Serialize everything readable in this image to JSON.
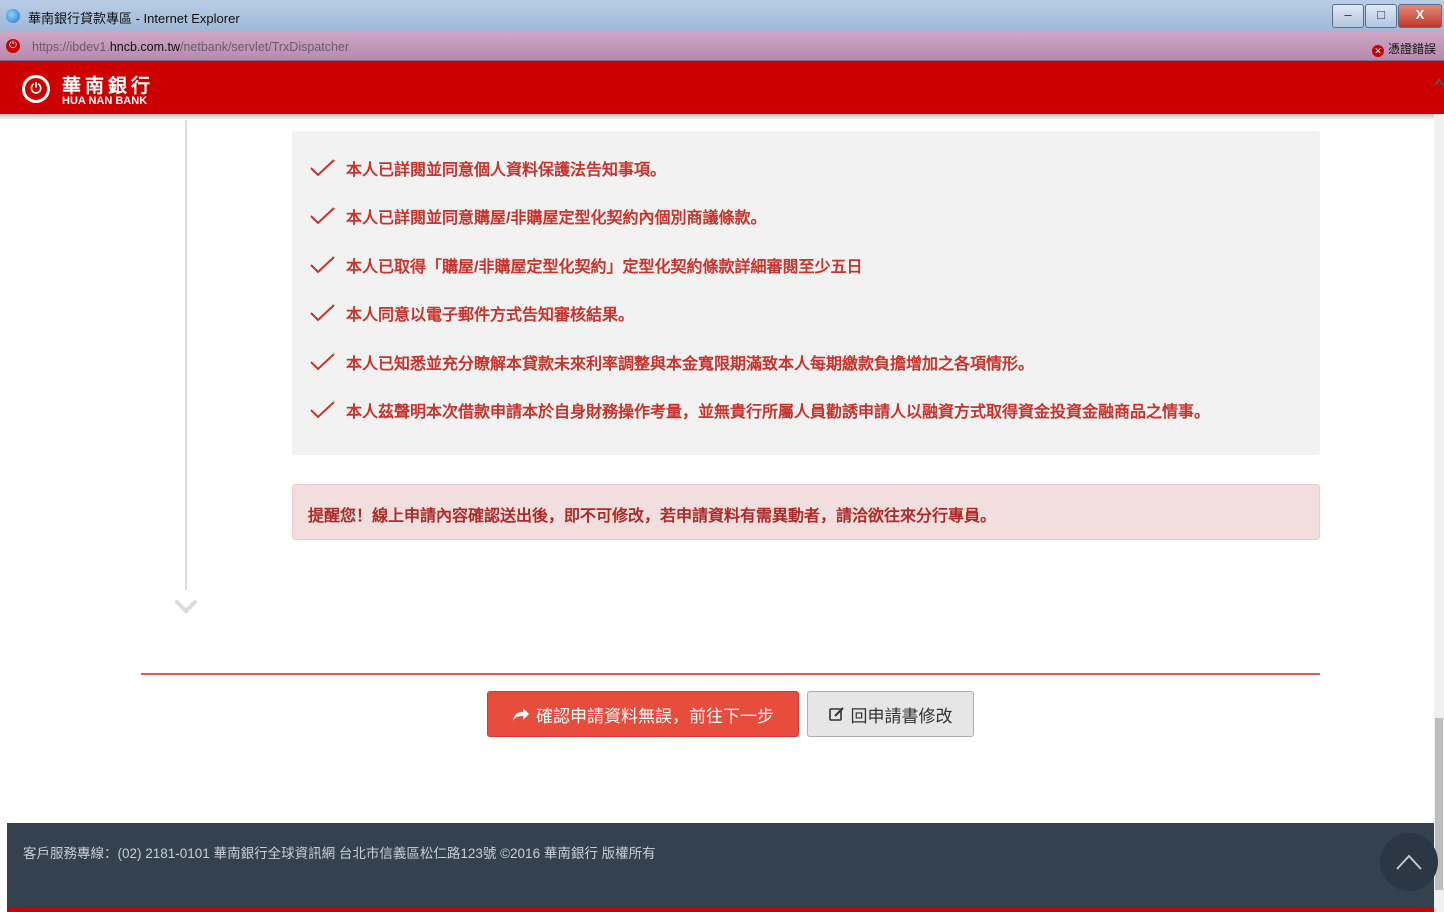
{
  "window": {
    "title": "華南銀行貸款專區 - Internet Explorer",
    "url_prefix": "https://ibdev1.",
    "url_domain": "hncb.com.tw",
    "url_path": "/netbank/servlet/TrxDispatcher",
    "cert_error": "憑證錯誤",
    "min_label": "–",
    "max_label": "□",
    "close_label": "X"
  },
  "brand": {
    "name_zh": "華南銀行",
    "name_en": "HUA NAN BANK",
    "color": "#cc0000"
  },
  "checklist": [
    "本人已詳閱並同意個人資料保護法告知事項。",
    "本人已詳閱並同意購屋/非購屋定型化契約內個別商議條款。",
    "本人已取得「購屋/非購屋定型化契約」定型化契約條款詳細審閱至少五日",
    "本人同意以電子郵件方式告知審核結果。",
    "本人已知悉並充分瞭解本貸款未來利率調整與本金寬限期滿致本人每期繳款負擔增加之各項情形。",
    "本人茲聲明本次借款申請本於自身財務操作考量，並無貴行所屬人員勸誘申請人以融資方式取得資金投資金融商品之情事。"
  ],
  "reminder": "提醒您！線上申請內容確認送出後，即不可修改，若申請資料有需異動者，請洽欲往來分行專員。",
  "actions": {
    "confirm_label": "確認申請資料無誤，前往下一步",
    "edit_label": "回申請書修改"
  },
  "footer": {
    "text": "客戶服務專線：(02) 2181-0101   華南銀行全球資訊網   台北市信義區松仁路123號   ©2016 華南銀行 版權所有"
  },
  "colors": {
    "accent": "#e84c3d",
    "check": "#c9332b",
    "footer_bg": "#34414f"
  }
}
